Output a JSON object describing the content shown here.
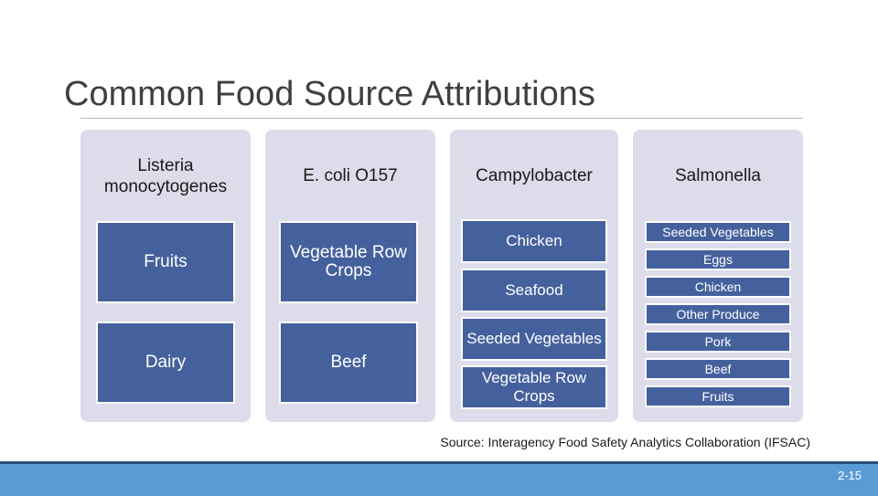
{
  "slide": {
    "title": "Common Food Source Attributions",
    "source_note": "Source: Interagency Food Safety Analytics Collaboration (IFSAC)",
    "page_number": "2-15",
    "colors": {
      "box_blue": "#45619d",
      "panel": "#dcdcea",
      "footer_bar": "#5b9bd5",
      "footer_border": "#2e4d7b",
      "title_text": "#3f3f3f"
    },
    "columns": [
      {
        "header": "Listeria monocytogenes",
        "items": [
          "Fruits",
          "Dairy"
        ]
      },
      {
        "header": "E. coli O157",
        "items": [
          "Vegetable Row Crops",
          "Beef"
        ]
      },
      {
        "header": "Campylobacter",
        "items": [
          "Chicken",
          "Seafood",
          "Seeded Vegetables",
          "Vegetable Row Crops"
        ]
      },
      {
        "header": "Salmonella",
        "items": [
          "Seeded Vegetables",
          "Eggs",
          "Chicken",
          "Other Produce",
          "Pork",
          "Beef",
          "Fruits"
        ]
      }
    ]
  }
}
